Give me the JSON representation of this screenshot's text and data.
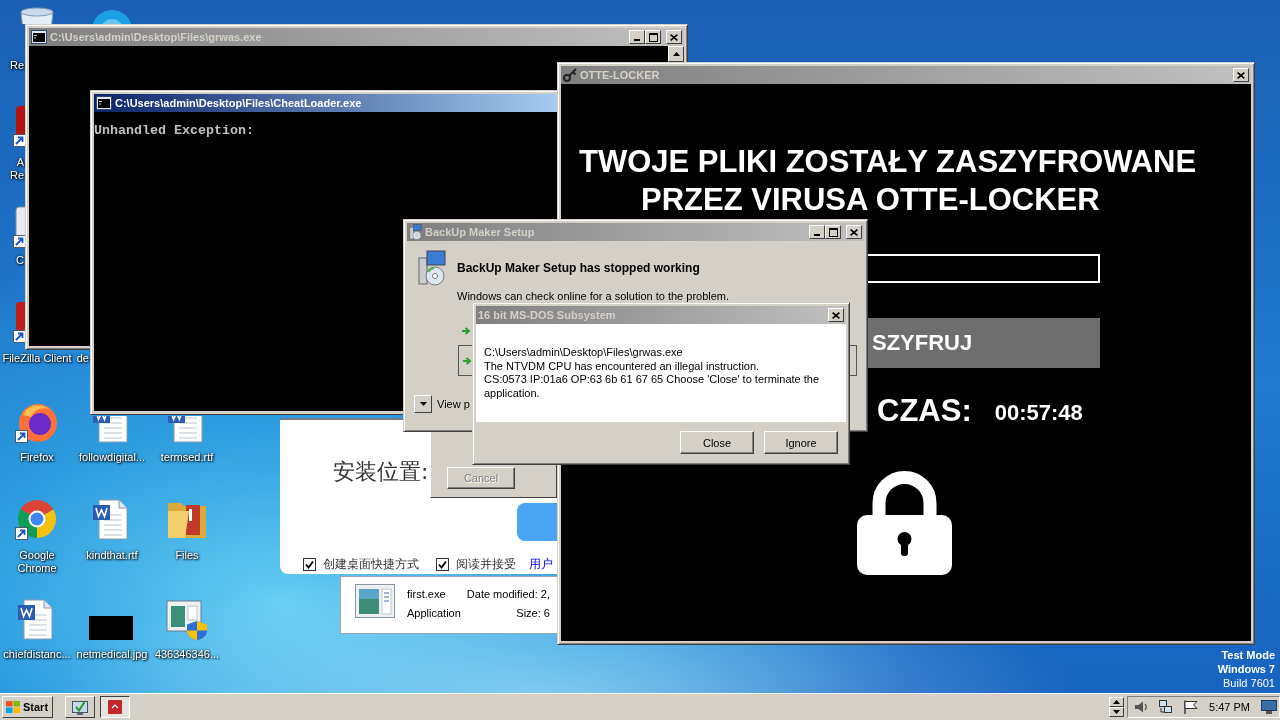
{
  "desktop": {
    "icons": [
      {
        "kind": "recycle-bin",
        "lines": [
          "Re"
        ]
      },
      {
        "kind": "chat"
      },
      {
        "kind": "pdf",
        "lines": [
          "A",
          "Re"
        ]
      },
      {
        "kind": "shortcut",
        "lines": [
          "C"
        ]
      },
      {
        "kind": "ftp-client",
        "lines": [
          "FileZilla Client"
        ]
      },
      {
        "lines": [
          "de"
        ]
      },
      {
        "kind": "firefox",
        "lines": [
          "Firefox"
        ]
      },
      {
        "kind": "document",
        "lines": [
          "followdigital..."
        ]
      },
      {
        "kind": "document",
        "lines": [
          "termsed.rtf"
        ]
      },
      {
        "kind": "chrome",
        "lines": [
          "Google",
          "Chrome"
        ]
      },
      {
        "kind": "document",
        "lines": [
          "kindthat.rtf"
        ]
      },
      {
        "kind": "folder",
        "lines": [
          "Files"
        ]
      },
      {
        "kind": "document",
        "lines": [
          "chiefdistanc..."
        ]
      },
      {
        "kind": "image",
        "lines": [
          "netmedical.jpg"
        ]
      },
      {
        "kind": "installer",
        "lines": [
          "436346346..."
        ]
      }
    ]
  },
  "windows": [
    {
      "kind": "console",
      "title": "C:\\Users\\admin\\Desktop\\Files\\grwas.exe",
      "active": false,
      "title_buttons": [
        {
          "kind": "minimize"
        },
        {
          "kind": "maximize"
        },
        {
          "kind": "close"
        }
      ],
      "scrollbar": true
    },
    {
      "kind": "console",
      "title": "C:\\Users\\admin\\Desktop\\Files\\CheatLoader.exe",
      "active": true,
      "lines": [
        "Unhandled Exception:"
      ]
    },
    {
      "kind": "locker",
      "title": "OTTE-LOCKER",
      "active": false,
      "title_buttons": [
        {
          "kind": "close"
        }
      ],
      "headline": [
        "TWOJE PLIKI ZOSTAŁY ZASZYFROWANE",
        "PRZEZ VIRUSA OTTE-LOCKER"
      ],
      "action_button": "SZYFRUJ",
      "timer_label": "CZAS:",
      "timer": "00:57:48"
    },
    {
      "kind": "error_report",
      "title": "BackUp Maker Setup",
      "active": false,
      "title_buttons": [
        {
          "kind": "minimize"
        },
        {
          "kind": "maximize"
        },
        {
          "kind": "close"
        }
      ],
      "heading": "BackUp Maker Setup has stopped working",
      "message": "Windows can check online for a solution to the problem.",
      "details_toggle": "View p"
    },
    {
      "kind": "message_box",
      "title": "16 bit MS-DOS Subsystem",
      "active": false,
      "title_buttons": [
        {
          "kind": "close"
        }
      ],
      "message_lines": [
        "C:\\Users\\admin\\Desktop\\Files\\grwas.exe",
        "The NTVDM CPU has encountered an illegal instruction.",
        "CS:0573 IP:01a6 OP:63 6b 61 67 65 Choose 'Close' to terminate the application."
      ],
      "buttons": [
        {
          "label": "Close"
        },
        {
          "label": "Ignore"
        }
      ]
    },
    {
      "kind": "installer",
      "location_label": "安装位置:",
      "checkboxes": [
        {
          "label": "创建桌面快捷方式",
          "checked": true
        },
        {
          "label": "阅读并接受",
          "checked": true
        }
      ],
      "link": "用户"
    },
    {
      "kind": "dialog",
      "buttons": [
        {
          "label": "Cancel",
          "disabled": true
        }
      ]
    },
    {
      "kind": "file_info",
      "name": "first.exe",
      "date_modified": "Date modified: 2,",
      "type": "Application",
      "size": "Size: 6"
    }
  ],
  "system_notice": [
    "Test Mode",
    "Windows 7",
    "Build 7601"
  ],
  "taskbar": {
    "start": "Start",
    "buttons": [
      {
        "kind": "program",
        "selected": false
      },
      {
        "kind": "app",
        "selected": true
      }
    ],
    "clock": "5:47 PM"
  }
}
